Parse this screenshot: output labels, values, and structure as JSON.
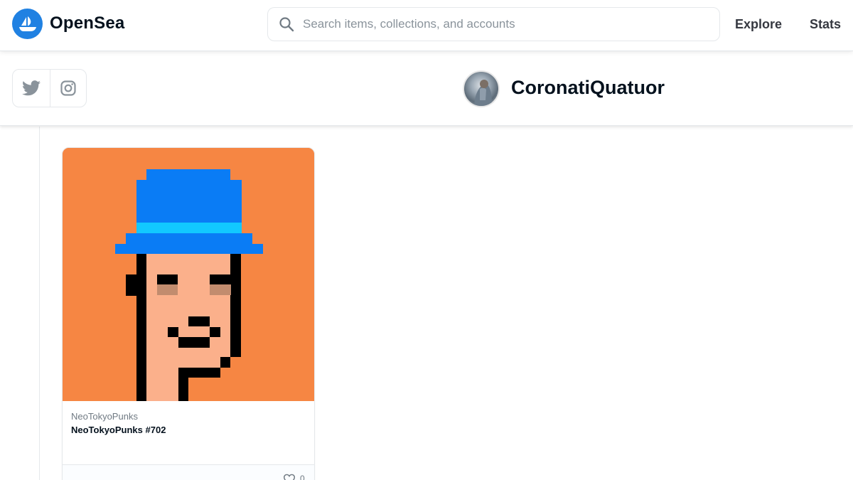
{
  "nav": {
    "brand": "OpenSea",
    "search_placeholder": "Search items, collections, and accounts",
    "links": [
      "Explore",
      "Stats"
    ],
    "accent_color": "#2081e2"
  },
  "profile": {
    "username": "CoronatiQuatuor",
    "socials": [
      "twitter-icon",
      "instagram-icon"
    ]
  },
  "item_card": {
    "collection": "NeoTokyoPunks",
    "name": "NeoTokyoPunks #702",
    "likes": "0",
    "image_background": "#f68643"
  }
}
